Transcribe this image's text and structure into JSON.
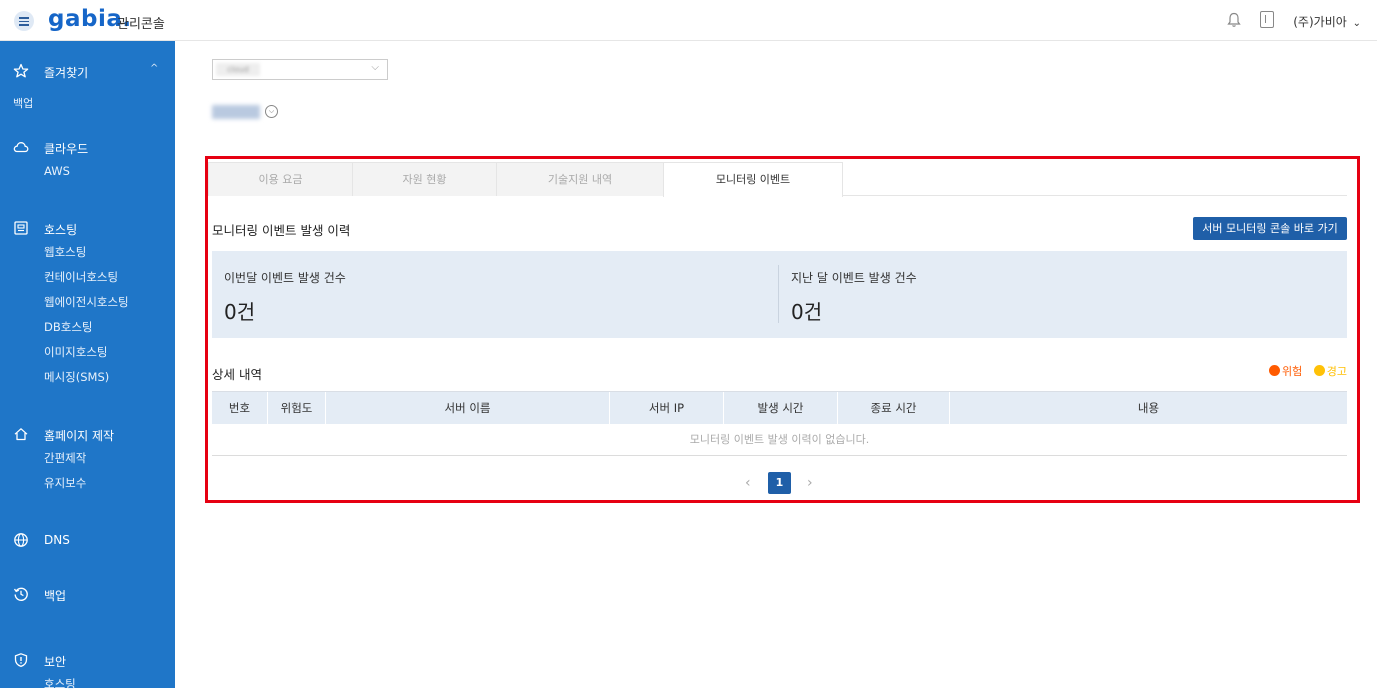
{
  "header": {
    "logo_text": "gabia.",
    "console_title": "관리콘솔",
    "user_name": "(주)가비아",
    "user_chevron": "⌄",
    "icons": [
      "hamburger-icon",
      "bell-icon",
      "document-icon"
    ]
  },
  "sidebar": {
    "favorites": {
      "label": "즐겨찾기",
      "caret": "^",
      "items": [
        "백업"
      ]
    },
    "groups": [
      {
        "icon": "cloud-icon",
        "label": "클라우드",
        "items": [
          "AWS"
        ]
      },
      {
        "icon": "hosting-icon",
        "label": "호스팅",
        "items": [
          "웹호스팅",
          "컨테이너호스팅",
          "웹에이전시호스팅",
          "DB호스팅",
          "이미지호스팅",
          "메시징(SMS)"
        ]
      },
      {
        "icon": "home-icon",
        "label": "홈페이지 제작",
        "items": [
          "간편제작",
          "유지보수"
        ]
      },
      {
        "icon": "globe-icon",
        "label": "DNS",
        "items": []
      },
      {
        "icon": "history-icon",
        "label": "백업",
        "items": []
      },
      {
        "icon": "shield-icon",
        "label": "보안",
        "items": [
          "호스팅"
        ]
      }
    ]
  },
  "selector": {
    "value": "cloud",
    "title": "cloud"
  },
  "tabs": [
    {
      "label": "이용 요금",
      "active": false
    },
    {
      "label": "자원 현황",
      "active": false
    },
    {
      "label": "기술지원 내역",
      "active": false
    },
    {
      "label": "모니터링 이벤트",
      "active": true
    }
  ],
  "history": {
    "title": "모니터링 이벤트 발생 이력",
    "link_button": "서버 모니터링 콘솔 바로 가기",
    "this_month_label": "이번달 이벤트 발생 건수",
    "this_month_value": "0건",
    "last_month_label": "지난 달 이벤트 발생 건수",
    "last_month_value": "0건"
  },
  "details": {
    "title": "상세 내역",
    "legend": [
      {
        "label": "위험",
        "color": "#ff5a00"
      },
      {
        "label": "경고",
        "color": "#ffc107"
      }
    ],
    "columns": [
      "번호",
      "위험도",
      "서버 이름",
      "서버 IP",
      "발생 시간",
      "종료 시간",
      "내용"
    ],
    "empty_message": "모니터링 이벤트 발생 이력이 없습니다."
  },
  "pagination": {
    "prev": "‹",
    "current": "1",
    "next": "›"
  },
  "colors": {
    "sidebar": "#1f76c8",
    "accent": "#1f5fa8",
    "highlight_frame": "#e60012"
  }
}
